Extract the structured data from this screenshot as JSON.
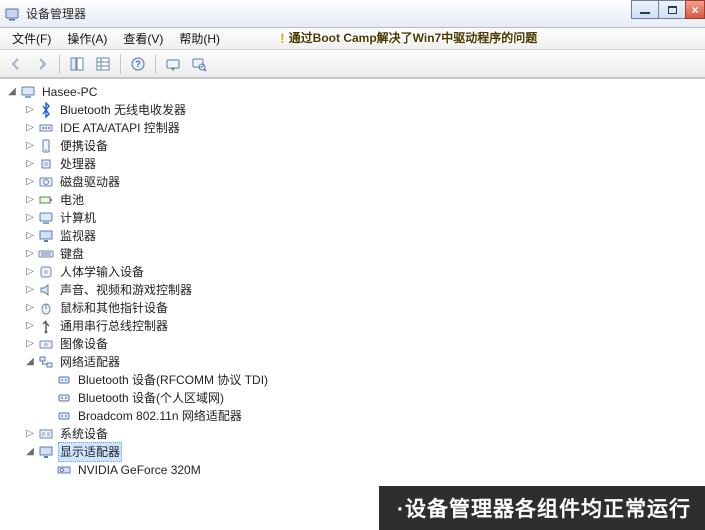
{
  "window": {
    "title": "设备管理器"
  },
  "menubar": {
    "items": [
      "文件(F)",
      "操作(A)",
      "查看(V)",
      "帮助(H)"
    ],
    "hint": "通过Boot Camp解决了Win7中驱动程序的问题"
  },
  "toolbar": {
    "buttons": [
      {
        "name": "back-icon",
        "disabled": true
      },
      {
        "name": "forward-icon",
        "disabled": true
      },
      {
        "name": "sep"
      },
      {
        "name": "show-hidden-icon"
      },
      {
        "name": "properties-grid-icon"
      },
      {
        "name": "sep"
      },
      {
        "name": "help-icon"
      },
      {
        "name": "sep"
      },
      {
        "name": "refresh-icon"
      },
      {
        "name": "scan-hardware-icon"
      }
    ]
  },
  "tree": {
    "root": {
      "label": "Hasee-PC",
      "expanded": true
    },
    "items": [
      {
        "label": "Bluetooth 无线电收发器",
        "icon": "bluetooth-icon",
        "exp": "▷"
      },
      {
        "label": "IDE ATA/ATAPI 控制器",
        "icon": "ide-icon",
        "exp": "▷"
      },
      {
        "label": "便携设备",
        "icon": "portable-icon",
        "exp": "▷"
      },
      {
        "label": "处理器",
        "icon": "cpu-icon",
        "exp": "▷"
      },
      {
        "label": "磁盘驱动器",
        "icon": "disk-icon",
        "exp": "▷"
      },
      {
        "label": "电池",
        "icon": "battery-icon",
        "exp": "▷"
      },
      {
        "label": "计算机",
        "icon": "computer-icon",
        "exp": "▷"
      },
      {
        "label": "监视器",
        "icon": "monitor-icon",
        "exp": "▷"
      },
      {
        "label": "键盘",
        "icon": "keyboard-icon",
        "exp": "▷"
      },
      {
        "label": "人体学输入设备",
        "icon": "hid-icon",
        "exp": "▷"
      },
      {
        "label": "声音、视频和游戏控制器",
        "icon": "sound-icon",
        "exp": "▷"
      },
      {
        "label": "鼠标和其他指针设备",
        "icon": "mouse-icon",
        "exp": "▷"
      },
      {
        "label": "通用串行总线控制器",
        "icon": "usb-icon",
        "exp": "▷"
      },
      {
        "label": "图像设备",
        "icon": "imaging-icon",
        "exp": "▷"
      },
      {
        "label": "网络适配器",
        "icon": "network-icon",
        "exp": "◢",
        "expanded": true,
        "children": [
          {
            "label": "Bluetooth 设备(RFCOMM 协议 TDI)",
            "icon": "net-dev-icon"
          },
          {
            "label": "Bluetooth 设备(个人区域网)",
            "icon": "net-dev-icon"
          },
          {
            "label": "Broadcom 802.11n 网络适配器",
            "icon": "net-dev-icon"
          }
        ]
      },
      {
        "label": "系统设备",
        "icon": "system-icon",
        "exp": "▷"
      },
      {
        "label": "显示适配器",
        "icon": "display-icon",
        "exp": "◢",
        "expanded": true,
        "selected": true,
        "children": [
          {
            "label": "NVIDIA GeForce 320M",
            "icon": "gpu-icon"
          }
        ]
      }
    ]
  },
  "caption": "·设备管理器各组件均正常运行"
}
